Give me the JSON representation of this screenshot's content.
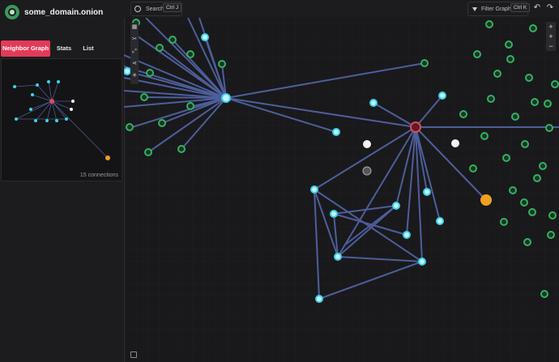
{
  "app": {
    "title": "some_domain.onion"
  },
  "tabs": [
    {
      "label": "Neighbor Graph",
      "active": true
    },
    {
      "label": "Stats",
      "active": false
    },
    {
      "label": "List",
      "active": false
    }
  ],
  "minimap": {
    "connections_label": "15 connections"
  },
  "search": {
    "label": "Search",
    "shortcut": "Ctrl J"
  },
  "filter": {
    "label": "Filter Graph",
    "shortcut": "Ctrl K"
  },
  "colors": {
    "accent": "#e23b5a",
    "green_node": "#2e9a57",
    "cyan_node": "#3fd2e6",
    "edge": "#5566a0",
    "orange_node": "#f0a020",
    "center_node": "#e04a5a"
  },
  "icons": {
    "toolbar": [
      "select-icon",
      "cut-icon",
      "expand-icon",
      "share-icon",
      "settings-icon"
    ],
    "zoom": [
      "zoom-in-icon",
      "zoom-out-icon"
    ],
    "top_right": [
      "undo-icon",
      "redo-icon"
    ]
  }
}
